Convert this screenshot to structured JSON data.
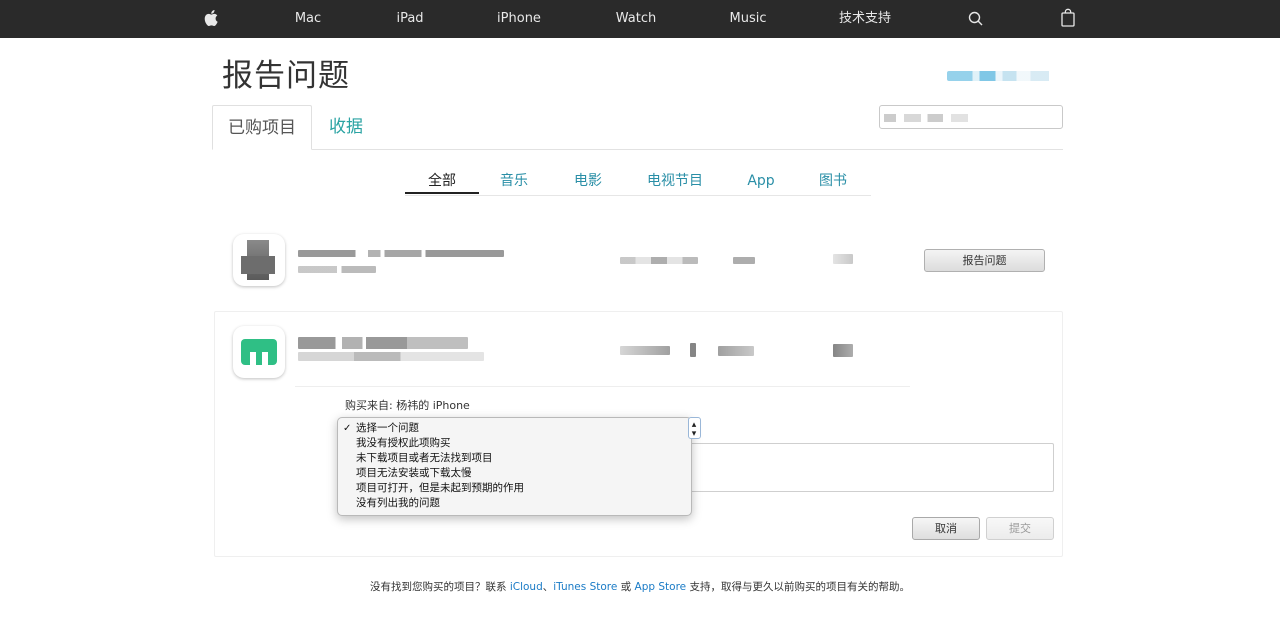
{
  "nav": {
    "items": [
      "Mac",
      "iPad",
      "iPhone",
      "Watch",
      "Music",
      "技术支持"
    ],
    "apple_icon": "apple-logo-icon",
    "search_icon": "search-icon",
    "bag_icon": "shopping-bag-icon"
  },
  "header": {
    "title": "报告问题",
    "tabs": [
      {
        "label": "已购项目",
        "active": true
      },
      {
        "label": "收据",
        "active": false
      }
    ]
  },
  "categories": [
    {
      "label": "全部",
      "active": true
    },
    {
      "label": "音乐",
      "active": false
    },
    {
      "label": "电影",
      "active": false
    },
    {
      "label": "电视节目",
      "active": false
    },
    {
      "label": "App",
      "active": false
    },
    {
      "label": "图书",
      "active": false
    }
  ],
  "rows": [
    {
      "action_label": "报告问题"
    }
  ],
  "expanded": {
    "purchased_from": "购买来自: 杨祎的 iPhone",
    "problem_options": [
      "选择一个问题",
      "我没有授权此项购买",
      "未下载项目或者无法找到项目",
      "项目无法安装或下载太慢",
      "项目可打开，但是未起到预期的作用",
      "没有列出我的问题"
    ],
    "selected_index": 0,
    "check_mark": "✓",
    "select_arrows": "▴▾",
    "cancel_label": "取消",
    "submit_label": "提交"
  },
  "footer": {
    "prefix": "没有找到您购买的项目？联系 ",
    "icloud": "iCloud",
    "sep1": "、",
    "itunes": "iTunes Store",
    "sep2": " 或 ",
    "appstore": "App Store",
    "suffix": " 支持，取得与更久以前购买的项目有关的帮助。"
  },
  "colors": {
    "nav_bg": "#2a2a2a",
    "accent_teal": "#2aa3a3",
    "link_blue": "#1a7bc6"
  }
}
